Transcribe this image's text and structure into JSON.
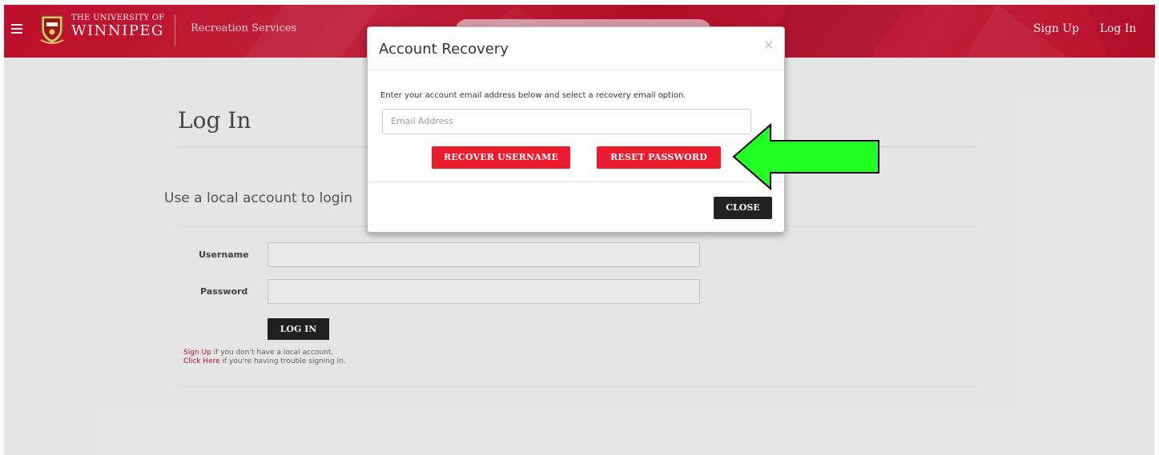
{
  "navbar": {
    "university_small": "THE UNIVERSITY OF",
    "university_big": "WINNIPEG",
    "brand": "Recreation Services",
    "signup": "Sign Up",
    "login": "Log In"
  },
  "page": {
    "title": "Log In",
    "local_title": "Use a local account to login",
    "username_label": "Username",
    "password_label": "Password",
    "login_button": "LOG IN",
    "help": [
      {
        "link": "Sign Up",
        "text": " if you don't have a local account."
      },
      {
        "link": "Click Here",
        "text": "  if you're having trouble signing in."
      }
    ]
  },
  "modal": {
    "title": "Account Recovery",
    "close_x": "×",
    "instructions": "Enter your account email address below and select a recovery email option.",
    "email_placeholder": "Email Address",
    "recover_username": "RECOVER USERNAME",
    "reset_password": "RESET PASSWORD",
    "close_button": "CLOSE"
  },
  "colors": {
    "brand_red": "#c8102e",
    "button_red": "#ec1c2e",
    "arrow_green": "#22ff22"
  }
}
